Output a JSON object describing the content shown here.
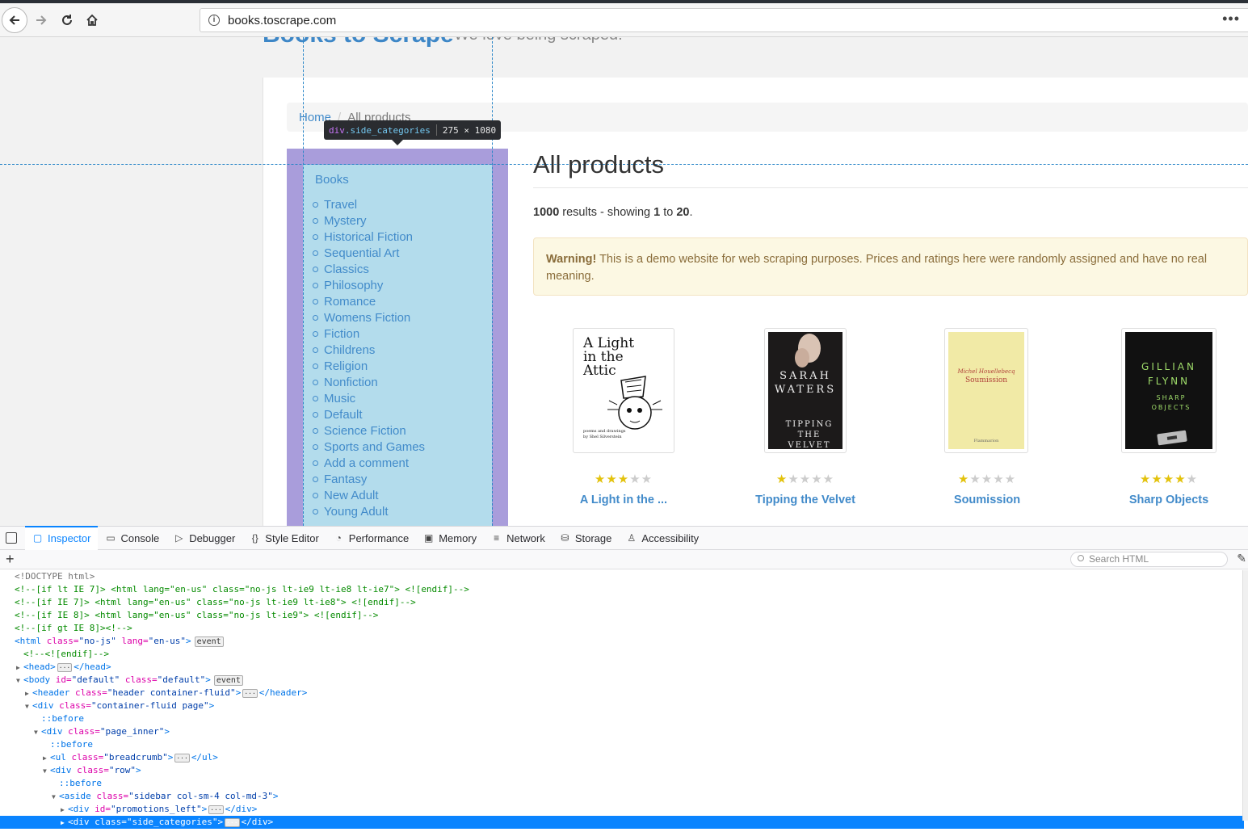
{
  "browser": {
    "url": "books.toscrape.com",
    "more_label": "•••"
  },
  "site": {
    "title": "Books to Scrape",
    "tagline": "We love being scraped!",
    "breadcrumb": {
      "home": "Home",
      "separator": "/",
      "active": "All products"
    },
    "side_title": "Books",
    "categories": [
      "Travel",
      "Mystery",
      "Historical Fiction",
      "Sequential Art",
      "Classics",
      "Philosophy",
      "Romance",
      "Womens Fiction",
      "Fiction",
      "Childrens",
      "Religion",
      "Nonfiction",
      "Music",
      "Default",
      "Science Fiction",
      "Sports and Games",
      "Add a comment",
      "Fantasy",
      "New Adult",
      "Young Adult"
    ],
    "heading": "All products",
    "results": {
      "count": "1000",
      "text1": " results - showing ",
      "from": "1",
      "to_word": " to ",
      "to": "20",
      "end": "."
    },
    "warning": {
      "strong": "Warning!",
      "text": " This is a demo website for web scraping purposes. Prices and ratings here were randomly assigned and have no real meaning."
    },
    "books": [
      {
        "title": "A Light in the ...",
        "rating": 3,
        "cover_text": [
          "A Light",
          "in the",
          "Attic"
        ],
        "cover_sub": "poems and drawings by Shel Silverstein"
      },
      {
        "title": "Tipping the Velvet",
        "rating": 1,
        "cover_text": [
          "SARAH",
          "WATERS"
        ],
        "cover_sub": "TIPPING THE VELVET"
      },
      {
        "title": "Soumission",
        "rating": 1,
        "cover_text": [
          "Michel Houellebecq",
          "Soumission"
        ],
        "cover_sub": "Flammarion"
      },
      {
        "title": "Sharp Objects",
        "rating": 4,
        "cover_text": [
          "GILLIAN",
          "FLYNN"
        ],
        "cover_sub": "SHARP OBJECTS"
      }
    ]
  },
  "inspector_tooltip": {
    "tag": "div",
    "cls": ".side_categories",
    "dims": "275 × 1080"
  },
  "devtools": {
    "tabs": [
      {
        "label": "Inspector",
        "icon": "inspector-icon",
        "glyph": "▢",
        "active": true
      },
      {
        "label": "Console",
        "icon": "console-icon",
        "glyph": "▭",
        "active": false
      },
      {
        "label": "Debugger",
        "icon": "debugger-icon",
        "glyph": "▷",
        "active": false
      },
      {
        "label": "Style Editor",
        "icon": "style-editor-icon",
        "glyph": "{}",
        "active": false
      },
      {
        "label": "Performance",
        "icon": "performance-icon",
        "glyph": "◔",
        "active": false
      },
      {
        "label": "Memory",
        "icon": "memory-icon",
        "glyph": "▣",
        "active": false
      },
      {
        "label": "Network",
        "icon": "network-icon",
        "glyph": "≡",
        "active": false
      },
      {
        "label": "Storage",
        "icon": "storage-icon",
        "glyph": "⛁",
        "active": false
      },
      {
        "label": "Accessibility",
        "icon": "accessibility-icon",
        "glyph": "♙",
        "active": false
      }
    ],
    "search_placeholder": "Search HTML",
    "add_label": "+",
    "markup": [
      {
        "indent": 0,
        "twisty": "",
        "parts": [
          [
            "c-plain",
            "<!DOCTYPE html>"
          ]
        ]
      },
      {
        "indent": 0,
        "twisty": "",
        "parts": [
          [
            "c-comment",
            "<!--[if lt IE 7]> <html lang=\"en-us\" class=\"no-js lt-ie9 lt-ie8 lt-ie7\"> <![endif]-->"
          ]
        ]
      },
      {
        "indent": 0,
        "twisty": "",
        "parts": [
          [
            "c-comment",
            "<!--[if IE 7]> <html lang=\"en-us\" class=\"no-js lt-ie9 lt-ie8\"> <![endif]-->"
          ]
        ]
      },
      {
        "indent": 0,
        "twisty": "",
        "parts": [
          [
            "c-comment",
            "<!--[if IE 8]> <html lang=\"en-us\" class=\"no-js lt-ie9\"> <![endif]-->"
          ]
        ]
      },
      {
        "indent": 0,
        "twisty": "",
        "parts": [
          [
            "c-comment",
            "<!--[if gt IE 8]><!-->"
          ]
        ]
      },
      {
        "indent": 0,
        "twisty": "",
        "parts": [
          [
            "c-tag",
            "<html "
          ],
          [
            "c-attr",
            "class="
          ],
          [
            "c-val",
            "\"no-js\" "
          ],
          [
            "c-attr",
            "lang="
          ],
          [
            "c-val",
            "\"en-us\""
          ],
          [
            "c-tag",
            ">"
          ]
        ],
        "badge": "event"
      },
      {
        "indent": 1,
        "twisty": "",
        "parts": [
          [
            "c-comment",
            "<!--<![endif]-->"
          ]
        ]
      },
      {
        "indent": 1,
        "twisty": "▶",
        "parts": [
          [
            "c-tag",
            "<head>"
          ],
          [
            "dots",
            "···"
          ],
          [
            "c-tag",
            "</head>"
          ]
        ]
      },
      {
        "indent": 1,
        "twisty": "▼",
        "parts": [
          [
            "c-tag",
            "<body "
          ],
          [
            "c-attr",
            "id="
          ],
          [
            "c-val",
            "\"default\" "
          ],
          [
            "c-attr",
            "class="
          ],
          [
            "c-val",
            "\"default\""
          ],
          [
            "c-tag",
            ">"
          ]
        ],
        "badge": "event"
      },
      {
        "indent": 2,
        "twisty": "▶",
        "parts": [
          [
            "c-tag",
            "<header "
          ],
          [
            "c-attr",
            "class="
          ],
          [
            "c-val",
            "\"header container-fluid\""
          ],
          [
            "c-tag",
            ">"
          ],
          [
            "dots",
            "···"
          ],
          [
            "c-tag",
            "</header>"
          ]
        ]
      },
      {
        "indent": 2,
        "twisty": "▼",
        "parts": [
          [
            "c-tag",
            "<div "
          ],
          [
            "c-attr",
            "class="
          ],
          [
            "c-val",
            "\"container-fluid page\""
          ],
          [
            "c-tag",
            ">"
          ]
        ]
      },
      {
        "indent": 3,
        "twisty": "",
        "parts": [
          [
            "c-pseudo",
            "::before"
          ]
        ]
      },
      {
        "indent": 3,
        "twisty": "▼",
        "parts": [
          [
            "c-tag",
            "<div "
          ],
          [
            "c-attr",
            "class="
          ],
          [
            "c-val",
            "\"page_inner\""
          ],
          [
            "c-tag",
            ">"
          ]
        ]
      },
      {
        "indent": 4,
        "twisty": "",
        "parts": [
          [
            "c-pseudo",
            "::before"
          ]
        ]
      },
      {
        "indent": 4,
        "twisty": "▶",
        "parts": [
          [
            "c-tag",
            "<ul "
          ],
          [
            "c-attr",
            "class="
          ],
          [
            "c-val",
            "\"breadcrumb\""
          ],
          [
            "c-tag",
            ">"
          ],
          [
            "dots",
            "···"
          ],
          [
            "c-tag",
            "</ul>"
          ]
        ]
      },
      {
        "indent": 4,
        "twisty": "▼",
        "parts": [
          [
            "c-tag",
            "<div "
          ],
          [
            "c-attr",
            "class="
          ],
          [
            "c-val",
            "\"row\""
          ],
          [
            "c-tag",
            ">"
          ]
        ]
      },
      {
        "indent": 5,
        "twisty": "",
        "parts": [
          [
            "c-pseudo",
            "::before"
          ]
        ]
      },
      {
        "indent": 5,
        "twisty": "▼",
        "parts": [
          [
            "c-tag",
            "<aside "
          ],
          [
            "c-attr",
            "class="
          ],
          [
            "c-val",
            "\"sidebar col-sm-4 col-md-3\""
          ],
          [
            "c-tag",
            ">"
          ]
        ]
      },
      {
        "indent": 6,
        "twisty": "▶",
        "parts": [
          [
            "c-tag",
            "<div "
          ],
          [
            "c-attr",
            "id="
          ],
          [
            "c-val",
            "\"promotions_left\""
          ],
          [
            "c-tag",
            ">"
          ],
          [
            "dots",
            "···"
          ],
          [
            "c-tag",
            "</div>"
          ]
        ]
      },
      {
        "indent": 6,
        "twisty": "▶",
        "parts": [
          [
            "c-tag",
            "<div "
          ],
          [
            "c-attr",
            "class="
          ],
          [
            "c-val",
            "\"side_categories\""
          ],
          [
            "c-tag",
            ">"
          ],
          [
            "dots",
            "···"
          ],
          [
            "c-tag",
            "</div>"
          ]
        ],
        "selected": true
      }
    ]
  }
}
